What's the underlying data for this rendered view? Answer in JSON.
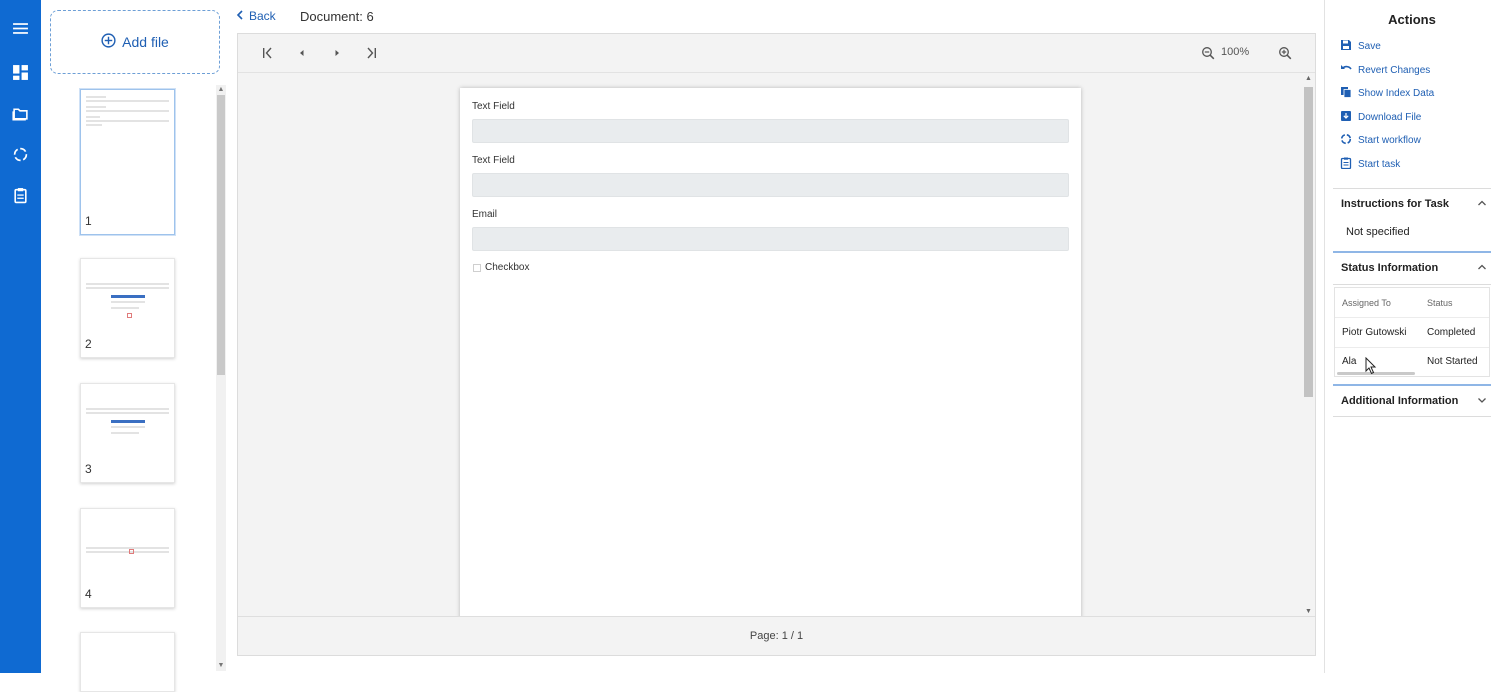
{
  "rail": {
    "icons": [
      "menu-icon",
      "dashboard-icon",
      "folder-icon",
      "workflow-icon",
      "clipboard-icon"
    ]
  },
  "thumbnails": {
    "add_file_label": "Add file",
    "pages": [
      {
        "number": "1",
        "selected": true
      },
      {
        "number": "2",
        "selected": false
      },
      {
        "number": "3",
        "selected": false
      },
      {
        "number": "4",
        "selected": false
      }
    ]
  },
  "header": {
    "back_label": "Back",
    "document_title": "Document: 6"
  },
  "viewer": {
    "zoom_level": "100%",
    "page_indicator": "Page: 1 / 1",
    "form": {
      "fields": [
        {
          "label": "Text Field",
          "value": ""
        },
        {
          "label": "Text Field",
          "value": ""
        },
        {
          "label": "Email",
          "value": ""
        }
      ],
      "checkbox_label": "Checkbox"
    }
  },
  "actions": {
    "title": "Actions",
    "items": [
      {
        "label": "Save",
        "icon": "save-icon"
      },
      {
        "label": "Revert Changes",
        "icon": "undo-icon"
      },
      {
        "label": "Show Index Data",
        "icon": "copy-icon"
      },
      {
        "label": "Download File",
        "icon": "download-icon"
      },
      {
        "label": "Start workflow",
        "icon": "workflow-icon"
      },
      {
        "label": "Start task",
        "icon": "clipboard-icon"
      }
    ]
  },
  "sections": {
    "instructions": {
      "title": "Instructions for Task",
      "value": "Not specified"
    },
    "status": {
      "title": "Status Information",
      "columns": [
        "Assigned To",
        "Status"
      ],
      "rows": [
        [
          "Piotr Gutowski",
          "Completed"
        ],
        [
          "Ala",
          "Not Started"
        ]
      ]
    },
    "additional": {
      "title": "Additional Information"
    }
  },
  "colors": {
    "brand": "#0f6ad2",
    "link": "#1f5fb3"
  }
}
